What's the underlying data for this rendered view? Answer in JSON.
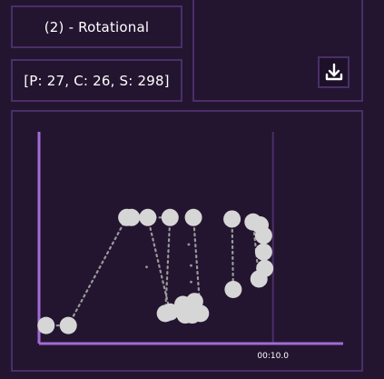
{
  "header": {
    "mode_label": "(2) - Rotational",
    "stats_label": "[P: 27, C: 26, S: 298]"
  },
  "actions": {
    "download_icon": "download-icon"
  },
  "colors": {
    "background": "#231530",
    "panel_border": "#4a2f66",
    "axis": "#a46ad6",
    "marker_line": "#4a2f66",
    "node_fill": "#d6d6d6",
    "edge": "#9a9a9a"
  },
  "chart_data": {
    "type": "scatter",
    "x_tick_labels": [
      "00:10.0"
    ],
    "nodes": [
      {
        "id": 0,
        "x": 0.0,
        "y": 0.06
      },
      {
        "id": 1,
        "x": 0.95,
        "y": 0.06
      },
      {
        "id": 2,
        "x": 3.45,
        "y": 0.78
      },
      {
        "id": 3,
        "x": 3.65,
        "y": 0.78
      },
      {
        "id": 4,
        "x": 4.35,
        "y": 0.78
      },
      {
        "id": 5,
        "x": 5.1,
        "y": 0.14
      },
      {
        "id": 6,
        "x": 5.3,
        "y": 0.15
      },
      {
        "id": 7,
        "x": 5.3,
        "y": 0.78
      },
      {
        "id": 8,
        "x": 5.85,
        "y": 0.2
      },
      {
        "id": 9,
        "x": 5.95,
        "y": 0.13
      },
      {
        "id": 10,
        "x": 6.2,
        "y": 0.2
      },
      {
        "id": 11,
        "x": 6.25,
        "y": 0.13
      },
      {
        "id": 12,
        "x": 6.35,
        "y": 0.22
      },
      {
        "id": 13,
        "x": 6.3,
        "y": 0.78
      },
      {
        "id": 14,
        "x": 6.6,
        "y": 0.14
      },
      {
        "id": 15,
        "x": 7.95,
        "y": 0.77
      },
      {
        "id": 16,
        "x": 8.0,
        "y": 0.3
      },
      {
        "id": 17,
        "x": 8.85,
        "y": 0.75
      },
      {
        "id": 18,
        "x": 9.15,
        "y": 0.73
      },
      {
        "id": 19,
        "x": 9.3,
        "y": 0.55
      },
      {
        "id": 20,
        "x": 9.3,
        "y": 0.66
      },
      {
        "id": 21,
        "x": 9.35,
        "y": 0.44
      },
      {
        "id": 22,
        "x": 9.1,
        "y": 0.37
      }
    ],
    "edges": [
      [
        0,
        1
      ],
      [
        1,
        2
      ],
      [
        3,
        4
      ],
      [
        2,
        7
      ],
      [
        7,
        5
      ],
      [
        4,
        6
      ],
      [
        13,
        14
      ],
      [
        15,
        16
      ],
      [
        17,
        22
      ],
      [
        18,
        19
      ],
      [
        19,
        21
      ],
      [
        20,
        22
      ],
      [
        9,
        12
      ],
      [
        8,
        11
      ]
    ],
    "loose_dots": [
      {
        "x": 4.3,
        "y": 0.45
      },
      {
        "x": 6.2,
        "y": 0.35
      },
      {
        "x": 6.2,
        "y": 0.46
      },
      {
        "x": 6.1,
        "y": 0.6
      }
    ],
    "xlim": [
      -0.3,
      12.7
    ],
    "ylim": [
      0,
      1
    ],
    "time_marker_x": 9.7
  }
}
